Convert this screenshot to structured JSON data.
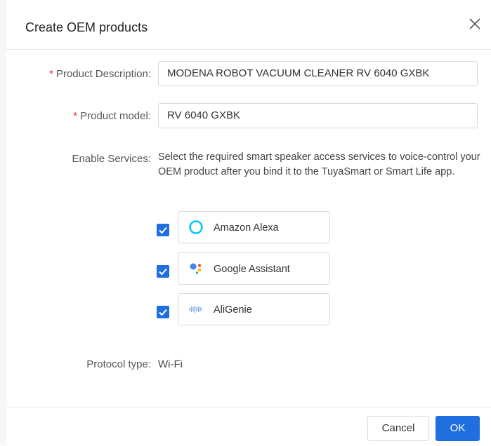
{
  "dialog": {
    "title": "Create OEM products",
    "close_icon": "close-icon"
  },
  "form": {
    "product_description": {
      "required_mark": "*",
      "label": "Product Description:",
      "value": "MODENA ROBOT VACUUM CLEANER RV 6040 GXBK"
    },
    "product_model": {
      "required_mark": "*",
      "label": "Product model:",
      "value": "RV 6040 GXBK"
    },
    "enable_services": {
      "label": "Enable Services:",
      "description": "Select the required smart speaker access services to voice-control your OEM product after you bind it to the TuyaSmart or Smart Life app.",
      "services": [
        {
          "label": "Amazon Alexa",
          "checked": true,
          "icon": "alexa-icon"
        },
        {
          "label": "Google Assistant",
          "checked": true,
          "icon": "google-assistant-icon"
        },
        {
          "label": "AliGenie",
          "checked": true,
          "icon": "aligenie-icon"
        }
      ]
    },
    "protocol_type": {
      "label": "Protocol type:",
      "value": "Wi-Fi"
    }
  },
  "footer": {
    "cancel_label": "Cancel",
    "ok_label": "OK"
  },
  "colors": {
    "primary": "#1f6fe0",
    "required": "#e0292f",
    "alexa": "#00caff"
  }
}
